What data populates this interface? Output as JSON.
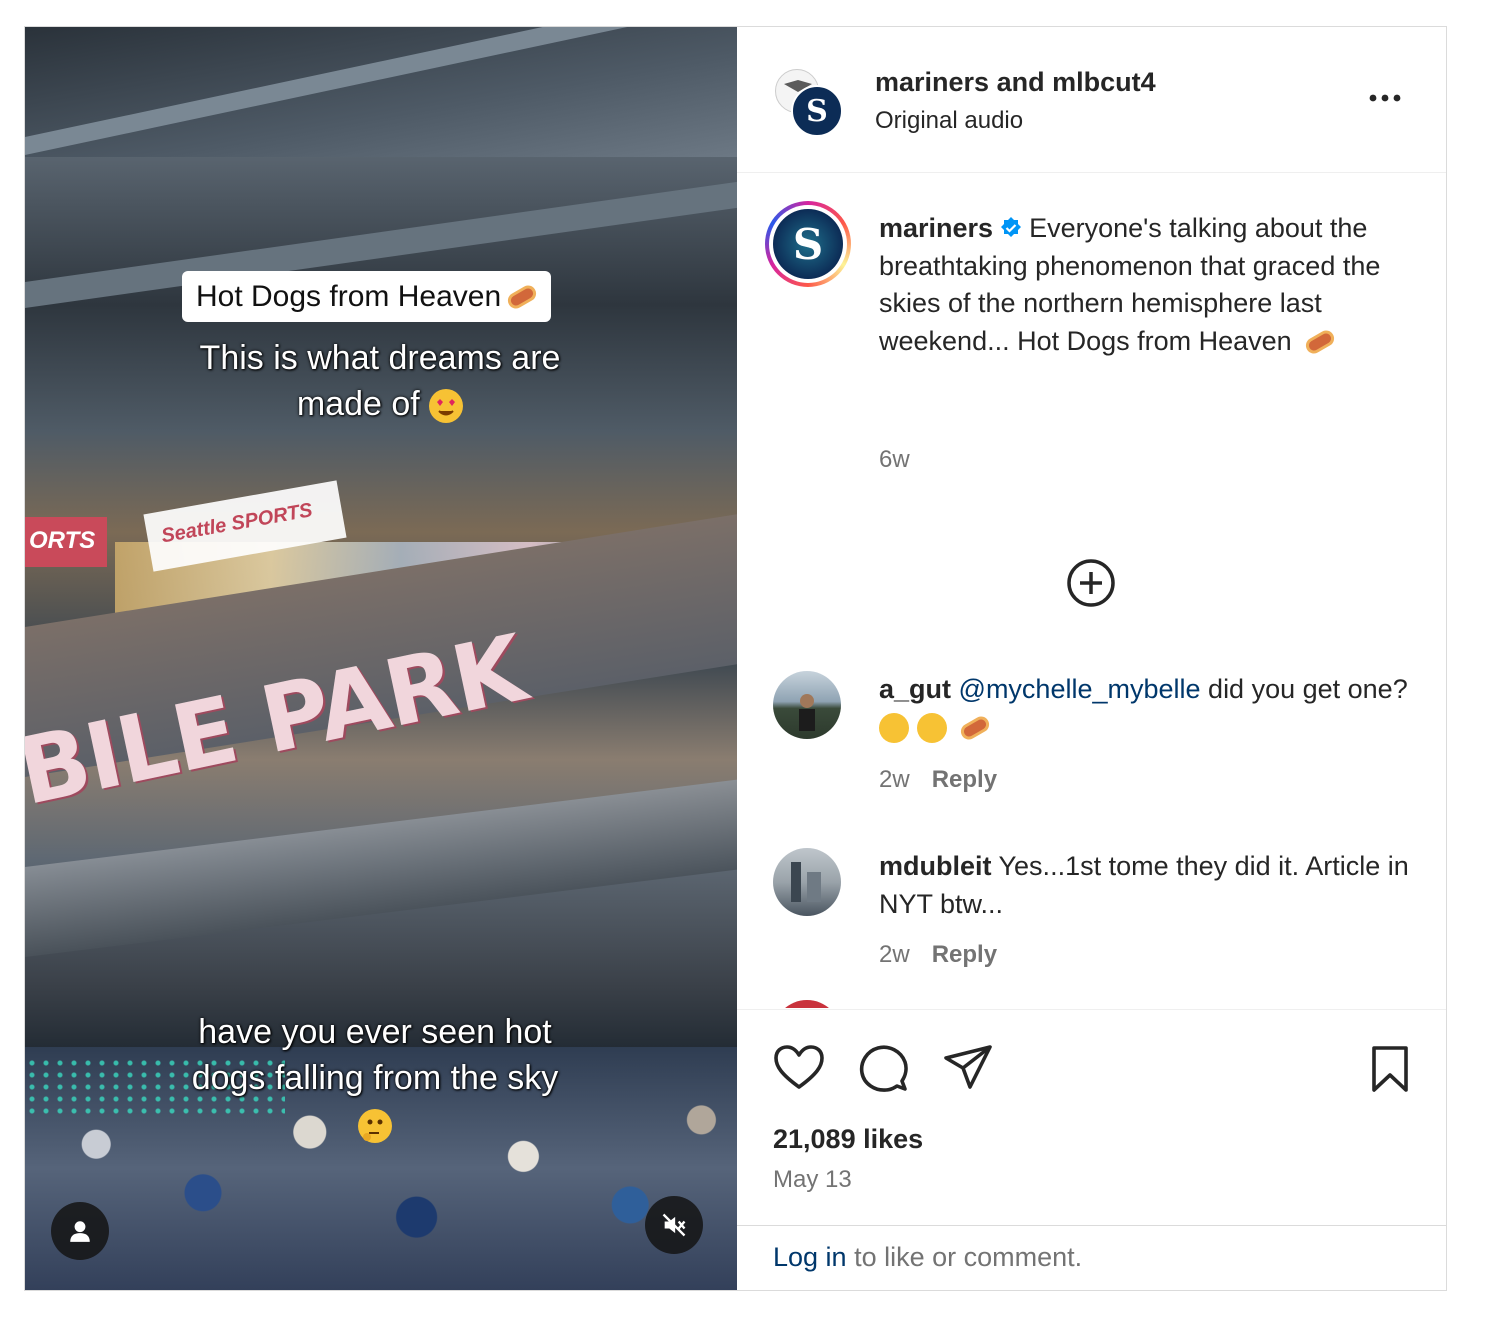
{
  "video": {
    "caption_box": "Hot Dogs from Heaven",
    "caption_middle_1": "This is what dreams are",
    "caption_middle_2": "made of",
    "caption_bottom_1": "have you ever seen hot",
    "caption_bottom_2": "dogs falling from the sky",
    "sign_park": "BILE PARK",
    "sign_orts": "ORTS",
    "sign_seattle": "Seattle SPORTS"
  },
  "header": {
    "authors": "mariners and mlbcut4",
    "audio": "Original audio",
    "more_label": "..."
  },
  "caption": {
    "username": "mariners",
    "text": "Everyone's talking about the breathtaking phenomenon that graced the skies of the northern hemisphere last weekend... Hot Dogs from Heaven",
    "time": "6w"
  },
  "comments": [
    {
      "username": "a_gut",
      "mention": "@mychelle_mybelle",
      "text": "did you get one?",
      "time": "2w",
      "reply_label": "Reply"
    },
    {
      "username": "mdubleit",
      "text": "Yes...1st tome they did it. Article in NYT btw...",
      "time": "2w",
      "reply_label": "Reply"
    }
  ],
  "stats": {
    "likes": "21,089 likes",
    "date": "May 13"
  },
  "login": {
    "link": "Log in",
    "text": " to like or comment."
  },
  "colors": {
    "link": "#00376b",
    "muted": "#737373",
    "verified": "#0095f6",
    "mariners_navy": "#0c2c56"
  },
  "icons": [
    "person-icon",
    "mute-icon",
    "more-icon",
    "verified-icon",
    "plus-circle-icon",
    "heart-icon",
    "comment-icon",
    "share-icon",
    "bookmark-icon"
  ]
}
